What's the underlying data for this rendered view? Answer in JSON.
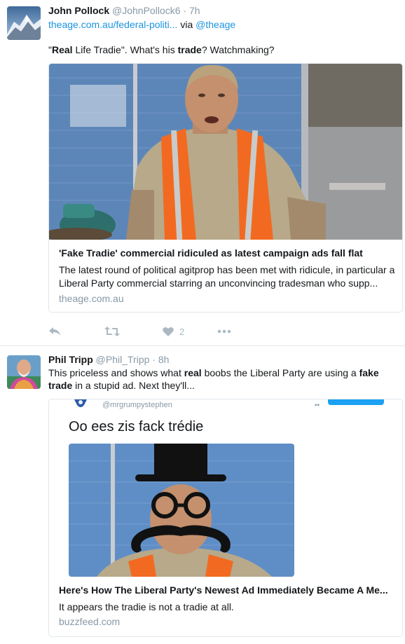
{
  "tweets": [
    {
      "name": "John Pollock",
      "handle": "@JohnPollock6",
      "separator": "·",
      "time": "7h",
      "link_text": "theage.com.au/federal-politi...",
      "via_text": "via",
      "via_handle": "@theage",
      "text_parts": [
        "\"",
        "Real",
        " Life Tradie\".  What's his ",
        "trade",
        "? Watchmaking?"
      ],
      "card": {
        "title": "'Fake Tradie' commercial ridiculed as latest campaign ads fall flat",
        "description": "The latest round of political agitprop has been met with ridicule, in particular a Liberal Party commercial starring an unconvincing tradesman who supp...",
        "domain": "theage.com.au"
      },
      "actions": {
        "reply_icon": "reply-icon",
        "retweet_icon": "retweet-icon",
        "like_icon": "heart-icon",
        "like_count": "2",
        "more_icon": "more-icon"
      }
    },
    {
      "name": "Phil Tripp",
      "handle": "@Phil_Tripp",
      "separator": "·",
      "time": "8h",
      "text_parts": [
        "This priceless and shows what ",
        "real",
        " boobs the Liberal Party are using a ",
        "fake",
        "",
        "trade",
        " in a stupid ad.  Next they'll..."
      ],
      "card": {
        "embed_handle": "@mrgrumpystephen",
        "embed_text": "Oo ees zis fack trédie",
        "title": "Here's How The Liberal Party's Newest Ad Immediately Became A Me...",
        "description": "It appears the tradie is not a tradie at all.",
        "domain": "buzzfeed.com"
      }
    }
  ],
  "colors": {
    "link": "#1b95e0",
    "muted": "#8899a6",
    "border": "#e1e8ed",
    "action": "#aab8c2",
    "vest": "#f26a21"
  }
}
